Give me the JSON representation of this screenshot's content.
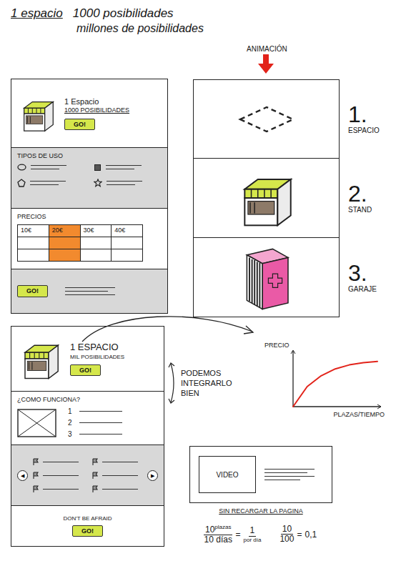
{
  "title": {
    "lead": "1 espacio",
    "rest": "1000 posibilidades",
    "second": "millones de posibilidades"
  },
  "wa": {
    "hero": {
      "title": "1 Espacio",
      "subtitle": "1000 POSIBILIDADES",
      "button": "GO!"
    },
    "uses": {
      "heading": "TIPOS DE USO"
    },
    "prices": {
      "heading": "PRECIOS",
      "columns": [
        {
          "label": "10€",
          "selected": false
        },
        {
          "label": "20€",
          "selected": true
        },
        {
          "label": "30€",
          "selected": false
        },
        {
          "label": "40€",
          "selected": false
        }
      ]
    },
    "footer": {
      "button": "GO!"
    }
  },
  "animation": {
    "label": "ANIMACIÓN",
    "steps": [
      {
        "number": "1.",
        "name": "ESPACIO",
        "kind": "space"
      },
      {
        "number": "2.",
        "name": "STAND",
        "kind": "stand"
      },
      {
        "number": "3.",
        "name": "GARAJE",
        "kind": "garage"
      }
    ]
  },
  "wb": {
    "hero": {
      "title": "1 ESPACIO",
      "subtitle": "MIL POSIBILIDADES",
      "button": "GO!"
    },
    "how": {
      "heading": "¿COMO FUNCIONA?",
      "steps": [
        "1",
        "2",
        "3"
      ]
    },
    "carousel": {
      "prev": "◀",
      "next": "▶"
    },
    "footer": {
      "text": "DON'T BE AFRAID",
      "button": "GO!"
    }
  },
  "note": {
    "lines": [
      "PODEMOS",
      "INTEGRARLO",
      "BIEN"
    ]
  },
  "chart": {
    "y_label": "PRECIO",
    "x_label": "PLAZAS/TIEMPO",
    "series": [
      {
        "values": [
          0,
          3.5,
          5.4,
          6.6,
          7.3,
          7.7,
          7.9
        ]
      }
    ]
  },
  "video": {
    "label": "VIDEO",
    "caption": "SIN RECARGAR LA PAGINA"
  },
  "math": {
    "first": {
      "num": "10",
      "unit": "plazas",
      "den": "10 días",
      "eq": "=",
      "result": "1",
      "note": "por día"
    },
    "second": {
      "num": "10",
      "den": "100",
      "eq": "=",
      "result": "0,1"
    }
  }
}
